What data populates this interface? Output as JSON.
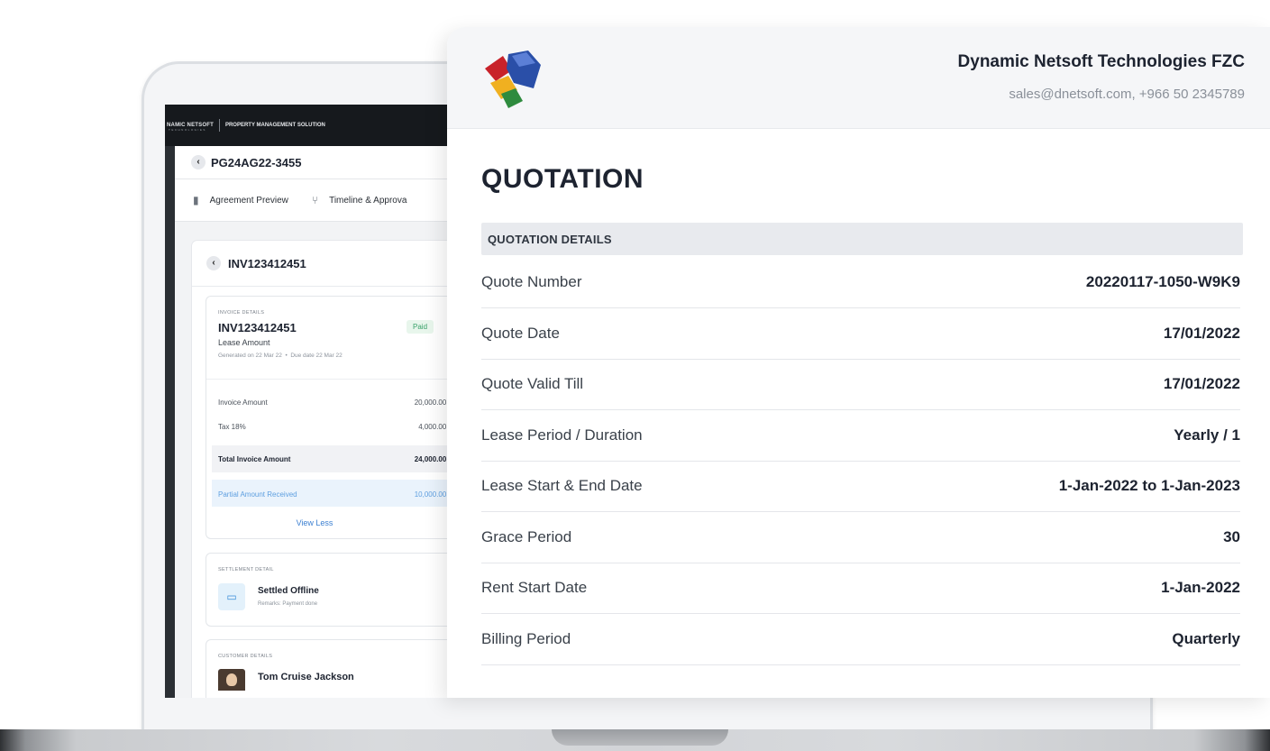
{
  "app": {
    "brand": "NAMIC NETSOFT",
    "brand_sub": "TECHNOLOGIES",
    "title": "PROPERTY MANAGEMENT SOLUTION"
  },
  "agreement": {
    "code": "PG24AG22-3455",
    "tabs": [
      {
        "label": "Agreement Preview",
        "icon": "document-icon"
      },
      {
        "label": "Timeline & Approva",
        "icon": "branch-icon"
      }
    ]
  },
  "invoice": {
    "header_code": "INV123412451",
    "details_label": "INVOICE DETAILS",
    "number": "INV123412451",
    "status": "Paid",
    "type": "Lease Amount",
    "generated": "Generated on 22 Mar 22",
    "due": "Due date 22 Mar 22",
    "lines": [
      {
        "label": "Invoice Amount",
        "amount": "20,000.00 $"
      },
      {
        "label": "Tax 18%",
        "amount": "4,000.00 $"
      }
    ],
    "total": {
      "label": "Total Invoice Amount",
      "amount": "24,000.00 $"
    },
    "partial": {
      "label": "Partial Amount Received",
      "amount": "10,000.00 $"
    },
    "view_less": "View Less"
  },
  "settlement": {
    "label": "SETTLEMENT DETAIL",
    "title": "Settled Offline",
    "remarks": "Remarks: Payment done"
  },
  "customer": {
    "label": "CUSTOMER DETAILS",
    "name": "Tom Cruise Jackson"
  },
  "quotation": {
    "company": "Dynamic Netsoft Technologies FZC",
    "contact": "sales@dnetsoft.com, +966 50 2345789",
    "title": "QUOTATION",
    "section": "QUOTATION DETAILS",
    "rows": [
      {
        "label": "Quote Number",
        "value": "20220117-1050-W9K9"
      },
      {
        "label": "Quote Date",
        "value": "17/01/2022"
      },
      {
        "label": "Quote Valid Till",
        "value": "17/01/2022"
      },
      {
        "label": "Lease Period / Duration",
        "value": "Yearly / 1"
      },
      {
        "label": "Lease Start & End Date",
        "value": "1-Jan-2022 to 1-Jan-2023"
      },
      {
        "label": "Grace Period",
        "value": "30"
      },
      {
        "label": "Rent Start Date",
        "value": "1-Jan-2022"
      },
      {
        "label": "Billing Period",
        "value": "Quarterly"
      }
    ]
  },
  "colors": {
    "paid_green": "#38a169",
    "link_blue": "#3b7fd1",
    "partial_blue": "#5e9fe0",
    "topbar": "#16191d"
  }
}
